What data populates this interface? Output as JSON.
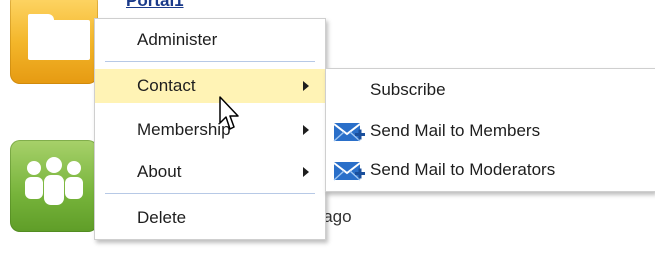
{
  "portal": {
    "title": "Portal1",
    "time_suffix": "s ago"
  },
  "context_menu": {
    "items": [
      {
        "label": "Administer",
        "has_submenu": false
      },
      {
        "label": "Contact",
        "has_submenu": true,
        "active": true
      },
      {
        "label": "Membership",
        "has_submenu": true
      },
      {
        "label": "About",
        "has_submenu": true
      },
      {
        "label": "Delete",
        "has_submenu": false
      }
    ]
  },
  "submenu": {
    "items": [
      {
        "label": "Subscribe",
        "icon": "none"
      },
      {
        "label": "Send Mail to Members",
        "icon": "mail-add-icon"
      },
      {
        "label": "Send Mail to Moderators",
        "icon": "mail-add-icon"
      }
    ]
  },
  "colors": {
    "highlight": "#fff3b5",
    "separator": "#b7c9e6",
    "folder_tile": "#f3b62a",
    "people_tile": "#76b33a",
    "mail_icon": "#2a6fc9"
  }
}
